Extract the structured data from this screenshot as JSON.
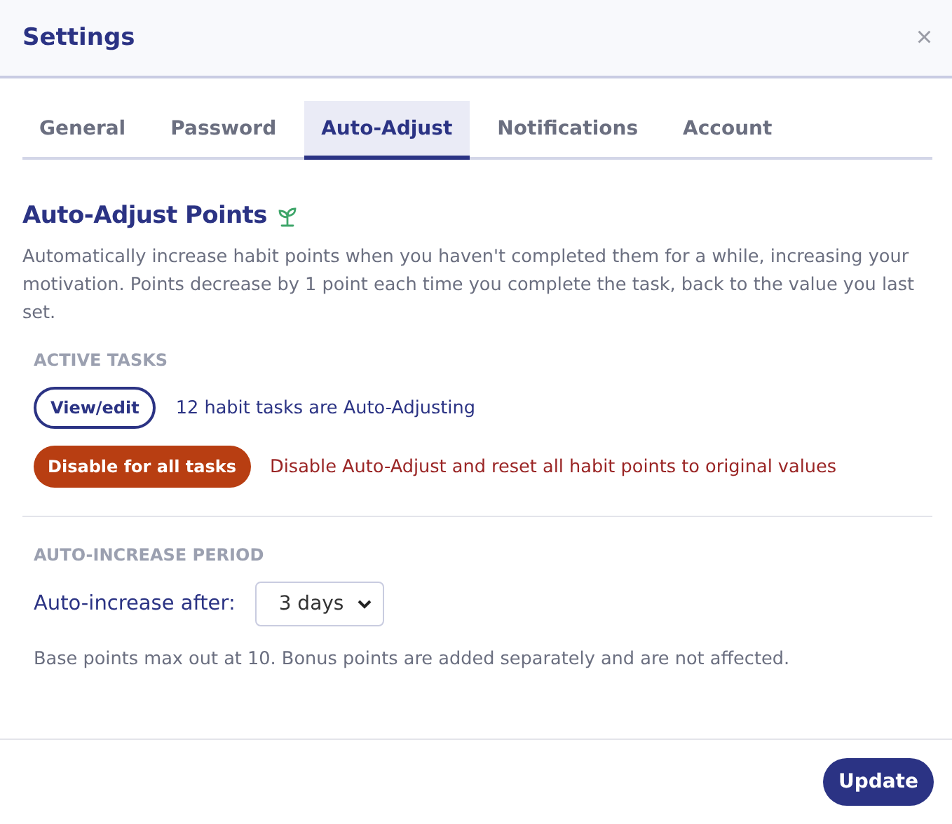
{
  "window": {
    "title": "Settings",
    "close": "×"
  },
  "tabs": [
    {
      "label": "General",
      "selected": false
    },
    {
      "label": "Password",
      "selected": false
    },
    {
      "label": "Auto-Adjust",
      "selected": true
    },
    {
      "label": "Notifications",
      "selected": false
    },
    {
      "label": "Account",
      "selected": false
    }
  ],
  "section": {
    "title": "Auto-Adjust Points",
    "description": "Automatically increase habit points when you haven't completed them for a while, increasing your motivation. Points decrease by 1 point each time you complete the task, back to the value you last set."
  },
  "active_tasks": {
    "heading": "ACTIVE TASKS",
    "view_button": "View/edit",
    "status": "12 habit tasks are Auto-Adjusting",
    "disable_button": "Disable for all tasks",
    "disable_note": "Disable Auto-Adjust and reset all habit points to original values"
  },
  "period": {
    "heading": "AUTO-INCREASE PERIOD",
    "label": "Auto-increase after:",
    "value": "3 days",
    "note": "Base points max out at 10. Bonus points are added separately and are not affected."
  },
  "footer": {
    "button": "Update"
  }
}
